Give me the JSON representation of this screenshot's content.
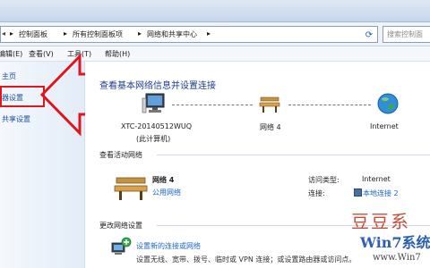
{
  "addressbar": {
    "crumbs": [
      "控制面板",
      "所有控制面板项",
      "网络和共享中心"
    ],
    "search_placeholder": "搜索控制面"
  },
  "menubar": {
    "items": [
      "编辑(E)",
      "查看(V)",
      "工具(T)",
      "帮助(H)"
    ]
  },
  "sidebar": {
    "items": [
      "主页",
      "器设置",
      "共享设置"
    ]
  },
  "main": {
    "title": "查看基本网络信息并设置连接",
    "map": {
      "computer_name": "XTC-20140512WUQ",
      "computer_sub": "(此计算机)",
      "network_name": "网络 4",
      "internet_label": "Internet"
    },
    "active_title": "查看活动网络",
    "active": {
      "name": "网络 4",
      "type": "公用网络",
      "access_label": "访问类型:",
      "access_value": "Internet",
      "conn_label": "连接:",
      "conn_value": "本地连接 2"
    },
    "change_title": "更改网络设置",
    "setup_link": "设置新的连接或网络",
    "setup_desc": "设置无线、宽带、拨号、临时或 VPN 连接；或设置路由器或访问点。"
  },
  "watermark": {
    "line1": "豆豆系",
    "line2": "Win7系统",
    "line3": "www.Win7"
  }
}
